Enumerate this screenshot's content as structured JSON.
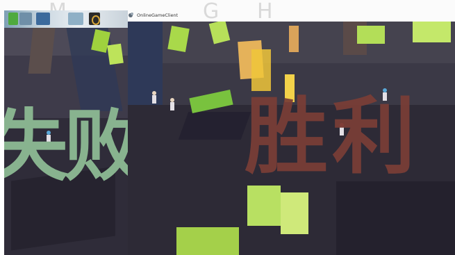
{
  "window": {
    "title": "OnlineGameClient",
    "icon": "unity-icon"
  },
  "taskbar_thumbnails": [
    "app-thumbnail",
    "app-thumbnail",
    "app-thumbnail",
    "app-thumbnail",
    "app-thumbnail"
  ],
  "background_text": "M G H",
  "left_view": {
    "outcome_label": "失败",
    "outcome_color": "#88b38f"
  },
  "right_view": {
    "outcome_label": "胜利",
    "outcome_color": "#7a3e36"
  }
}
